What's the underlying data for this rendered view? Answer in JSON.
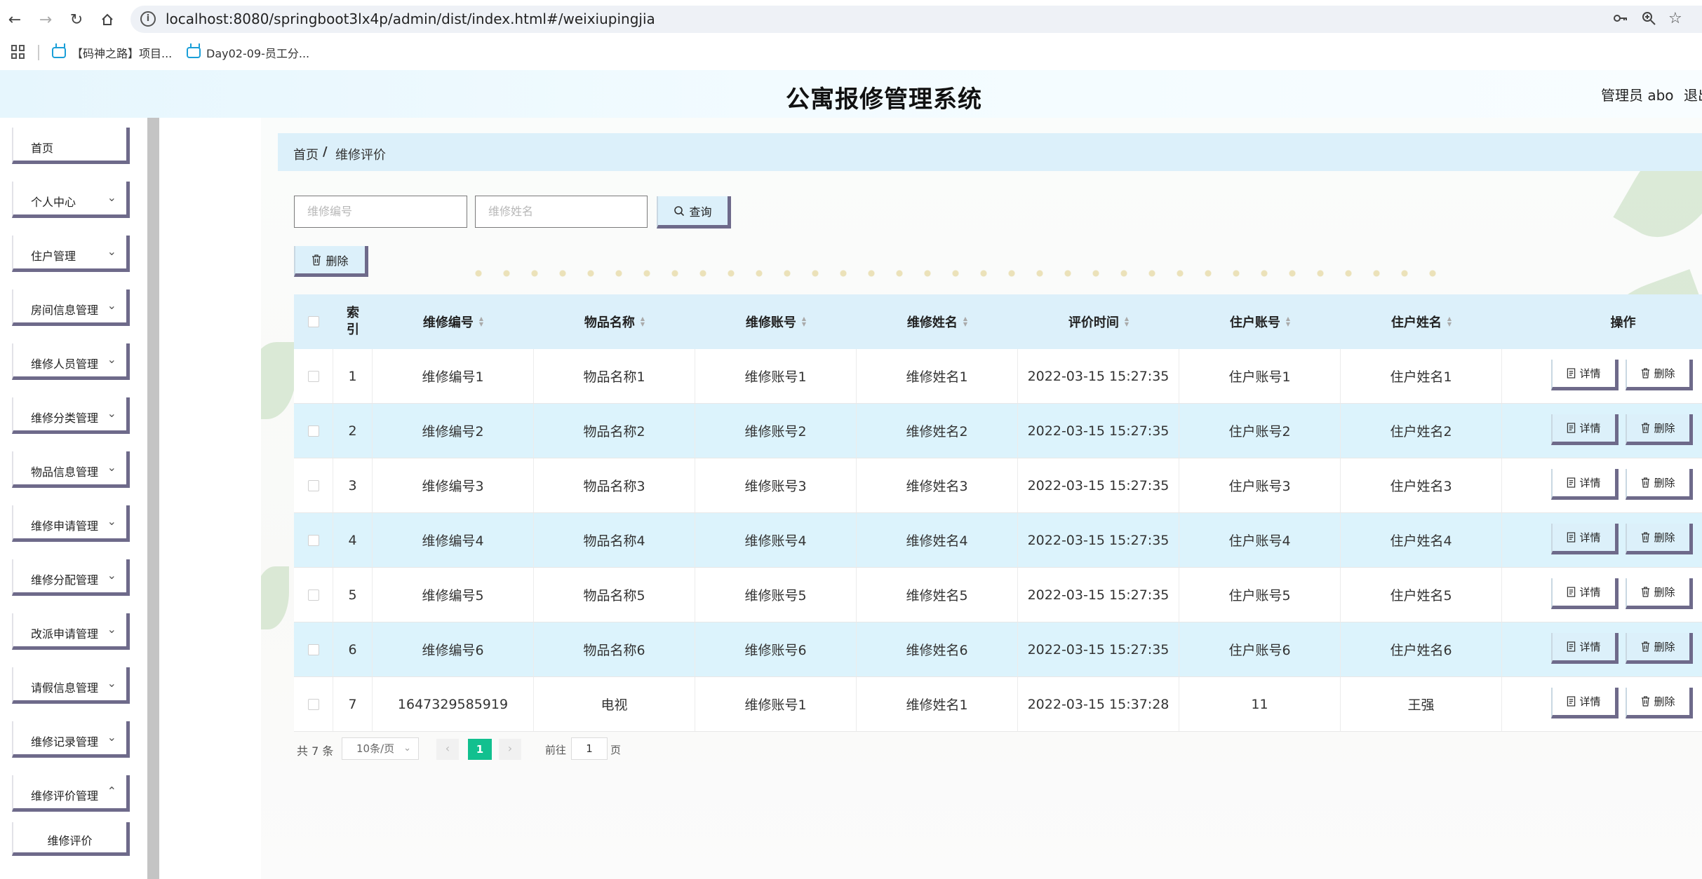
{
  "browser": {
    "url": "localhost:8080/springboot3lx4p/admin/dist/index.html#/weixiupingjia",
    "bookmarks": [
      "【码神之路】项目...",
      "Day02-09-员工分..."
    ]
  },
  "header": {
    "title": "公寓报修管理系统",
    "user": "管理员 abo",
    "logout": "退出登录"
  },
  "sidebar": {
    "items": [
      {
        "label": "首页"
      },
      {
        "label": "个人中心"
      },
      {
        "label": "住户管理"
      },
      {
        "label": "房间信息管理"
      },
      {
        "label": "维修人员管理"
      },
      {
        "label": "维修分类管理"
      },
      {
        "label": "物品信息管理"
      },
      {
        "label": "维修申请管理"
      },
      {
        "label": "维修分配管理"
      },
      {
        "label": "改派申请管理"
      },
      {
        "label": "请假信息管理"
      },
      {
        "label": "维修记录管理"
      },
      {
        "label": "维修评价管理"
      }
    ],
    "sub_item": "维修评价"
  },
  "breadcrumb": {
    "home": "首页",
    "separator": "/",
    "current": "维修评价"
  },
  "search": {
    "field1_placeholder": "维修编号",
    "field2_placeholder": "维修姓名",
    "query_label": "查询"
  },
  "toolbar": {
    "delete_label": "删除"
  },
  "table": {
    "headers": [
      "索引",
      "维修编号",
      "物品名称",
      "维修账号",
      "维修姓名",
      "评价时间",
      "住户账号",
      "住户姓名",
      "操作"
    ],
    "rows": [
      [
        "1",
        "维修编号1",
        "物品名称1",
        "维修账号1",
        "维修姓名1",
        "2022-03-15 15:27:35",
        "住户账号1",
        "住户姓名1"
      ],
      [
        "2",
        "维修编号2",
        "物品名称2",
        "维修账号2",
        "维修姓名2",
        "2022-03-15 15:27:35",
        "住户账号2",
        "住户姓名2"
      ],
      [
        "3",
        "维修编号3",
        "物品名称3",
        "维修账号3",
        "维修姓名3",
        "2022-03-15 15:27:35",
        "住户账号3",
        "住户姓名3"
      ],
      [
        "4",
        "维修编号4",
        "物品名称4",
        "维修账号4",
        "维修姓名4",
        "2022-03-15 15:27:35",
        "住户账号4",
        "住户姓名4"
      ],
      [
        "5",
        "维修编号5",
        "物品名称5",
        "维修账号5",
        "维修姓名5",
        "2022-03-15 15:27:35",
        "住户账号5",
        "住户姓名5"
      ],
      [
        "6",
        "维修编号6",
        "物品名称6",
        "维修账号6",
        "维修姓名6",
        "2022-03-15 15:27:35",
        "住户账号6",
        "住户姓名6"
      ],
      [
        "7",
        "1647329585919",
        "电视",
        "维修账号1",
        "维修姓名1",
        "2022-03-15 15:37:28",
        "11",
        "王强"
      ]
    ],
    "detail_label": "详情",
    "delete_label": "删除"
  },
  "pagination": {
    "total": "共 7 条",
    "page_size": "10条/页",
    "current_page": "1",
    "goto_label": "前往",
    "goto_value": "1",
    "page_suffix": "页"
  },
  "colors": {
    "accent": "#dcf0fa",
    "active_page": "#12c08f",
    "button_shadow": "#6e6a8a"
  }
}
